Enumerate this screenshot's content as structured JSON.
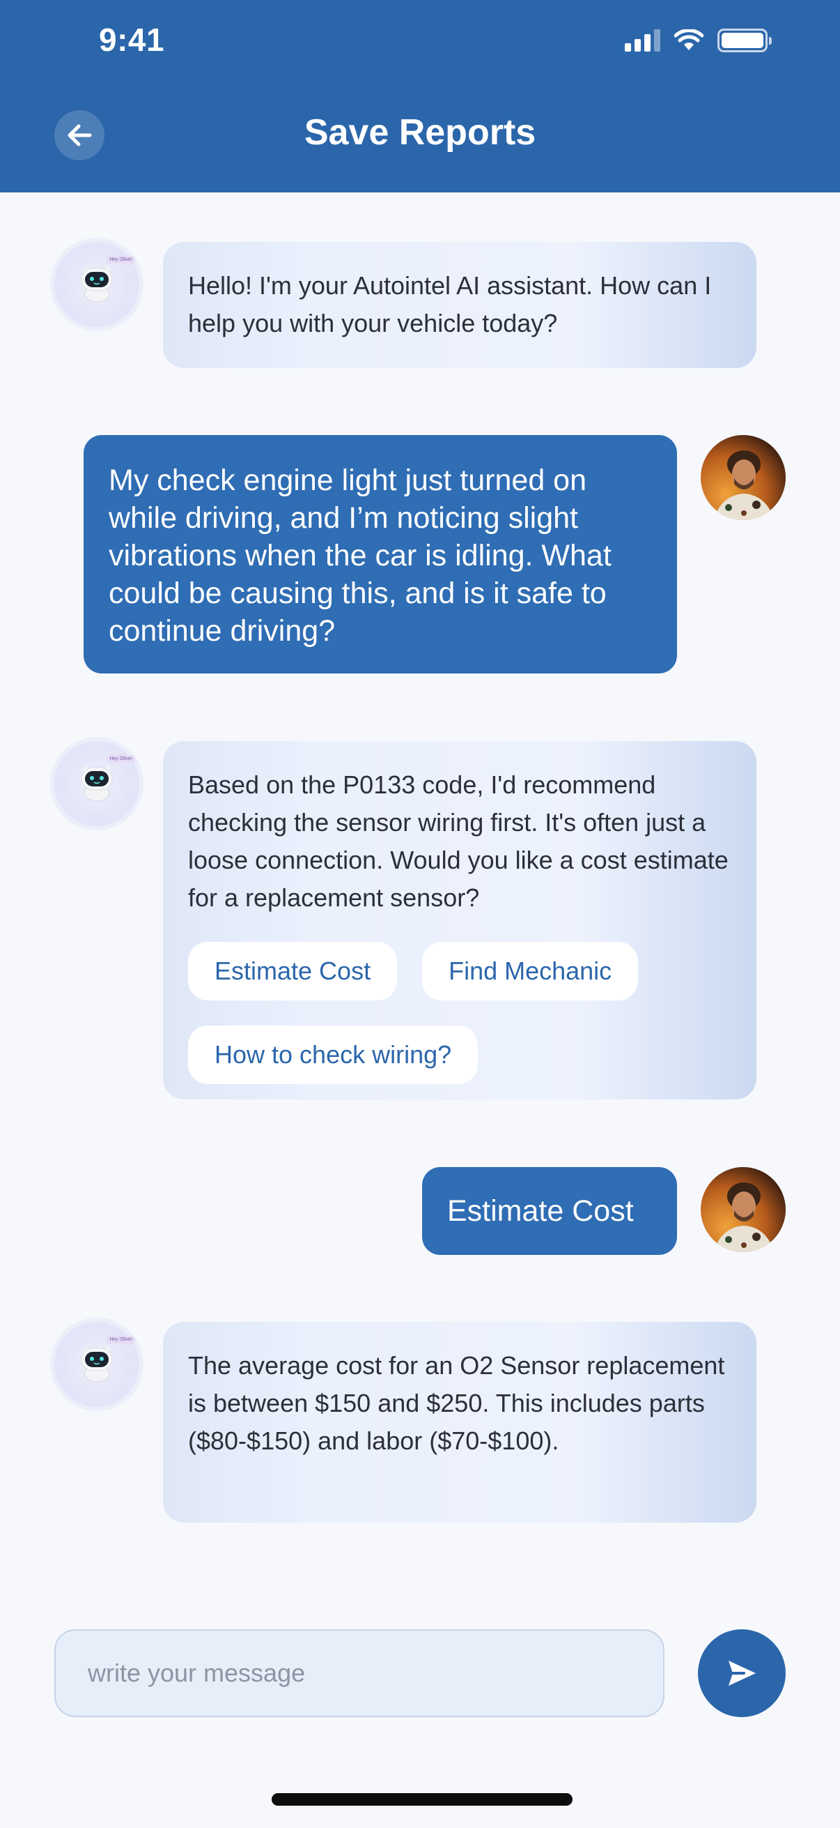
{
  "status_bar": {
    "time": "9:41"
  },
  "header": {
    "title": "Save Reports"
  },
  "messages": [
    {
      "sender": "bot",
      "text": "Hello! I'm your Autointel AI assistant. How can I help you with your vehicle today?"
    },
    {
      "sender": "user",
      "text": "My check engine light just turned on while driving, and I’m noticing slight vibrations when the car is idling. What could be causing this, and is it safe to continue driving?"
    },
    {
      "sender": "bot",
      "text": "Based on the P0133 code, I'd recommend checking the sensor wiring first. It's often just a loose connection. Would you like a cost estimate for a replacement sensor?",
      "chips": [
        "Estimate Cost",
        "Find Mechanic",
        "How to check wiring?"
      ]
    },
    {
      "sender": "user",
      "text": "Estimate Cost"
    },
    {
      "sender": "bot",
      "text": "The average cost for an O2 Sensor replacement is between $150 and $250. This includes parts ($80-$150) and labor ($70-$100)."
    }
  ],
  "bot_avatar_tag": "Hey Oliver",
  "composer": {
    "placeholder": "write your message",
    "value": ""
  },
  "colors": {
    "primary": "#2b66ab",
    "user_bubble": "#2f6db4",
    "background": "#f6f8fc"
  },
  "icons": {
    "back": "arrow-left-icon",
    "send": "send-icon",
    "signal": "cellular-signal-icon",
    "wifi": "wifi-icon",
    "battery": "battery-icon"
  }
}
